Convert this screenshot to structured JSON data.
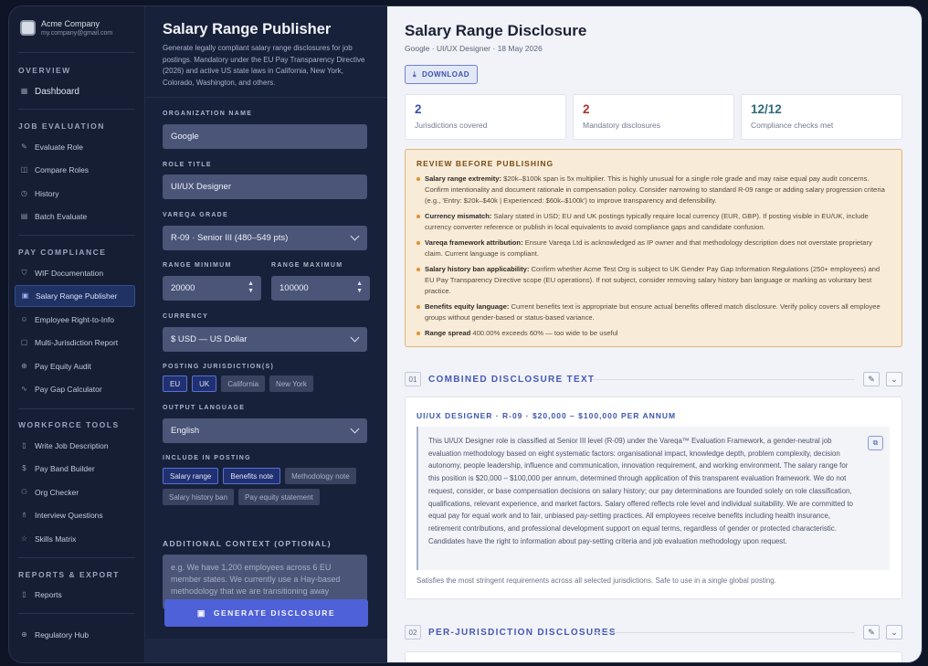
{
  "sidebar": {
    "company_name": "Acme Company",
    "company_email": "my.company@gmail.com",
    "overview_label": "OVERVIEW",
    "dashboard": "Dashboard",
    "job_eval_label": "JOB EVALUATION",
    "job_eval_items": [
      "Evaluate Role",
      "Compare Roles",
      "History",
      "Batch Evaluate"
    ],
    "pay_label": "PAY COMPLIANCE",
    "pay_items": [
      "WIF Documentation",
      "Salary Range Publisher",
      "Employee Right-to-Info",
      "Multi-Jurisdiction Report",
      "Pay Equity Audit",
      "Pay Gap Calculator"
    ],
    "workforce_label": "WORKFORCE TOOLS",
    "workforce_items": [
      "Write Job Description",
      "Pay Band Builder",
      "Org Checker",
      "Interview Questions",
      "Skills Matrix"
    ],
    "reports_label": "REPORTS & EXPORT",
    "reports_item": "Reports",
    "regulatory": "Regulatory Hub"
  },
  "form": {
    "title": "Salary Range Publisher",
    "description": "Generate legally compliant salary range disclosures for job postings. Mandatory under the EU Pay Transparency Directive (2026) and active US state laws in California, New York, Colorado, Washington, and others.",
    "org_label": "ORGANIZATION NAME",
    "org_value": "Google",
    "role_label": "ROLE TITLE",
    "role_value": "UI/UX Designer",
    "grade_label": "VAREQA GRADE",
    "grade_value": "R-09 · Senior III (480–549 pts)",
    "min_label": "RANGE MINIMUM",
    "min_value": "20000",
    "max_label": "RANGE MAXIMUM",
    "max_value": "100000",
    "currency_label": "CURRENCY",
    "currency_value": "$ USD — US Dollar",
    "jurisdiction_label": "POSTING JURISDICTION(S)",
    "jurisdictions": [
      {
        "label": "EU",
        "selected": true
      },
      {
        "label": "UK",
        "selected": true
      },
      {
        "label": "California",
        "selected": false
      },
      {
        "label": "New York",
        "selected": false
      }
    ],
    "language_label": "OUTPUT LANGUAGE",
    "language_value": "English",
    "include_label": "INCLUDE IN POSTING",
    "include_options": [
      {
        "label": "Salary range",
        "selected": true
      },
      {
        "label": "Benefits note",
        "selected": true
      },
      {
        "label": "Methodology note",
        "selected": false
      },
      {
        "label": "Salary history ban",
        "selected": false
      },
      {
        "label": "Pay equity statement",
        "selected": false
      }
    ],
    "context_label": "ADDITIONAL CONTEXT (OPTIONAL)",
    "context_placeholder": "e.g. We have 1,200 employees across 6 EU member states. We currently use a Hay-based methodology that we are transitioning away",
    "generate_label": "GENERATE DISCLOSURE"
  },
  "main": {
    "title": "Salary Range Disclosure",
    "subtitle": "Google · UI/UX Designer · 18 May 2026",
    "download_label": "DOWNLOAD",
    "stats": [
      {
        "value": "2",
        "label": "Jurisdictions covered",
        "color": "#3b4fb0"
      },
      {
        "value": "2",
        "label": "Mandatory disclosures",
        "color": "#b1322b"
      },
      {
        "value": "12/12",
        "label": "Compliance checks met",
        "color": "#2f6b7a"
      }
    ],
    "review_title": "REVIEW BEFORE PUBLISHING",
    "review_items": [
      {
        "bold": "Salary range extremity:",
        "text": " $20k–$100k span is 5x multiplier. This is highly unusual for a single role grade and may raise equal pay audit concerns. Confirm intentionality and document rationale in compensation policy. Consider narrowing to standard R-09 range or adding salary progression criteria (e.g., 'Entry: $20k–$40k | Experienced: $60k–$100k') to improve transparency and defensibility."
      },
      {
        "bold": "Currency mismatch:",
        "text": " Salary stated in USD; EU and UK postings typically require local currency (EUR, GBP). If posting visible in EU/UK, include currency converter reference or publish in local equivalents to avoid compliance gaps and candidate confusion."
      },
      {
        "bold": "Vareqa framework attribution:",
        "text": " Ensure Vareqa Ltd is acknowledged as IP owner and that methodology description does not overstate proprietary claim. Current language is compliant."
      },
      {
        "bold": "Salary history ban applicability:",
        "text": " Confirm whether Acme Test Org is subject to UK Gender Pay Gap Information Regulations (250+ employees) and EU Pay Transparency Directive scope (EU operations). If not subject, consider removing salary history ban language or marking as voluntary best practice."
      },
      {
        "bold": "Benefits equity language:",
        "text": " Current benefits text is appropriate but ensure actual benefits offered match disclosure. Verify policy covers all employee groups without gender-based or status-based variance."
      },
      {
        "bold": "Range spread",
        "text": " 400.00% exceeds 60% — too wide to be useful"
      }
    ],
    "section1_num": "01",
    "section1_title": "COMBINED DISCLOSURE TEXT",
    "card_title": "UI/UX DESIGNER · R-09 · $20,000 – $100,000 PER ANNUM",
    "card_body": "This UI/UX Designer role is classified at Senior III level (R-09) under the Vareqa™ Evaluation Framework, a gender-neutral job evaluation methodology based on eight systematic factors: organisational impact, knowledge depth, problem complexity, decision autonomy, people leadership, influence and communication, innovation requirement, and working environment. The salary range for this position is $20,000 – $100,000 per annum, determined through application of this transparent evaluation framework. We do not request, consider, or base compensation decisions on salary history; our pay determinations are founded solely on role classification, qualifications, relevant experience, and market factors. Salary offered reflects role level and individual suitability. We are committed to equal pay for equal work and to fair, unbiased pay-setting practices. All employees receive benefits including health insurance, retirement contributions, and professional development support on equal terms, regardless of gender or protected characteristic. Candidates have the right to information about pay-setting criteria and job evaluation methodology upon request.",
    "card_note": "Satisfies the most stringent requirements across all selected jurisdictions. Safe to use in a single global posting.",
    "section2_num": "02",
    "section2_title": "PER-JURISDICTION DISCLOSURES"
  }
}
